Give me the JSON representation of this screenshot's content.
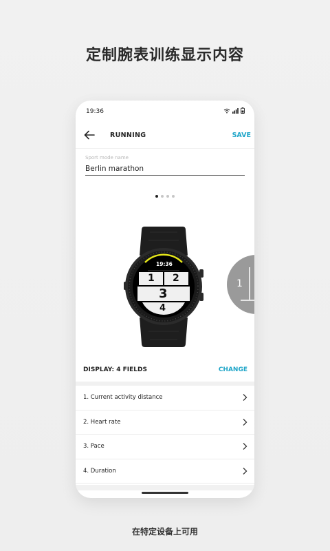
{
  "promo": {
    "title": "定制腕表训练显示内容",
    "footer": "在特定设备上可用"
  },
  "status_bar": {
    "time": "19:36"
  },
  "app_bar": {
    "title": "RUNNING",
    "save_label": "SAVE"
  },
  "sport_mode": {
    "label": "Sport mode name",
    "value": "Berlin marathon"
  },
  "carousel": {
    "page_count": 4,
    "active_index": 0
  },
  "watch_face": {
    "time": "19:36",
    "fields": [
      "1",
      "2",
      "3",
      "4"
    ]
  },
  "peek_watch": {
    "fields": [
      "1"
    ]
  },
  "display": {
    "label": "DISPLAY: 4 FIELDS",
    "change_label": "CHANGE"
  },
  "fields_list": [
    {
      "label": "1. Current activity distance"
    },
    {
      "label": "2. Heart rate"
    },
    {
      "label": "3. Pace"
    },
    {
      "label": "4. Duration"
    }
  ],
  "colors": {
    "accent": "#1ea5c8",
    "watch_yellow": "#e5e619"
  }
}
